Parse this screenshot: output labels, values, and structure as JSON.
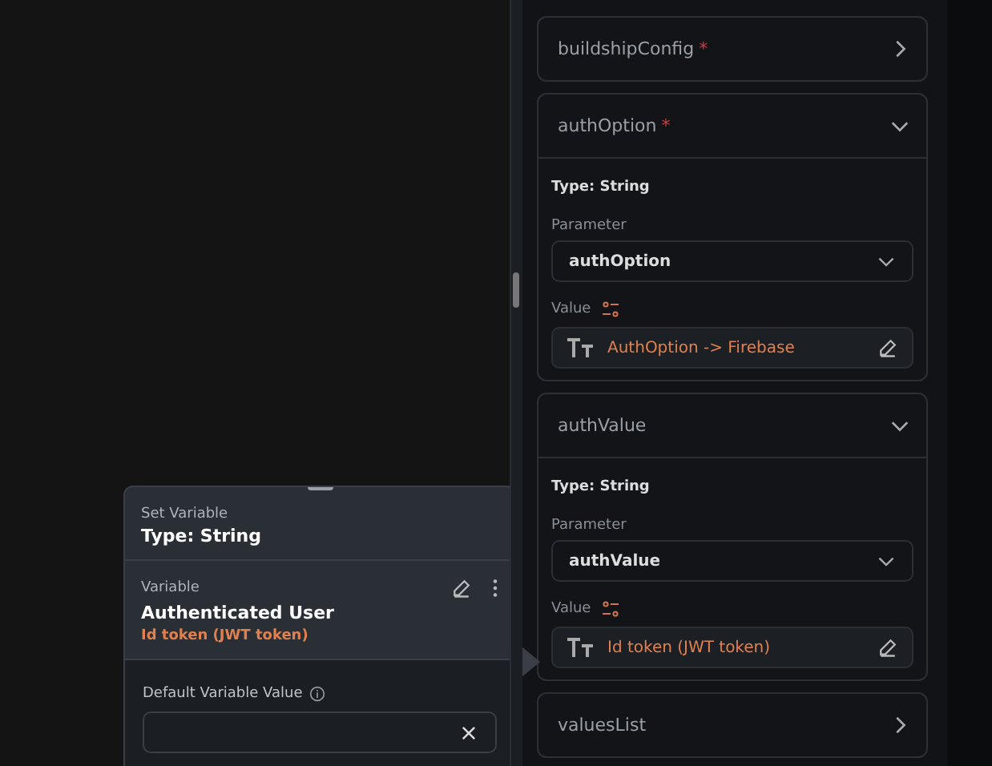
{
  "node": {
    "title": "Set Variable",
    "type": "Type: String",
    "variable_label": "Variable",
    "variable_name": "Authenticated User",
    "variable_value": "Id token (JWT token)",
    "default_label": "Default Variable Value"
  },
  "parameters": [
    {
      "name": "buildshipConfig",
      "required_mark": "*",
      "expanded": false
    },
    {
      "name": "authOption",
      "required_mark": "*",
      "expanded": true,
      "type": "Type: String",
      "parameter_label": "Parameter",
      "parameter": "authOption",
      "value_label": "Value",
      "value": "AuthOption -> Firebase"
    },
    {
      "name": "authValue",
      "expanded": true,
      "type": "Type: String",
      "parameter_label": "Parameter",
      "parameter": "authValue",
      "value_label": "Value",
      "value": "Id token (JWT token)"
    },
    {
      "name": "valuesList",
      "expanded": false
    }
  ]
}
